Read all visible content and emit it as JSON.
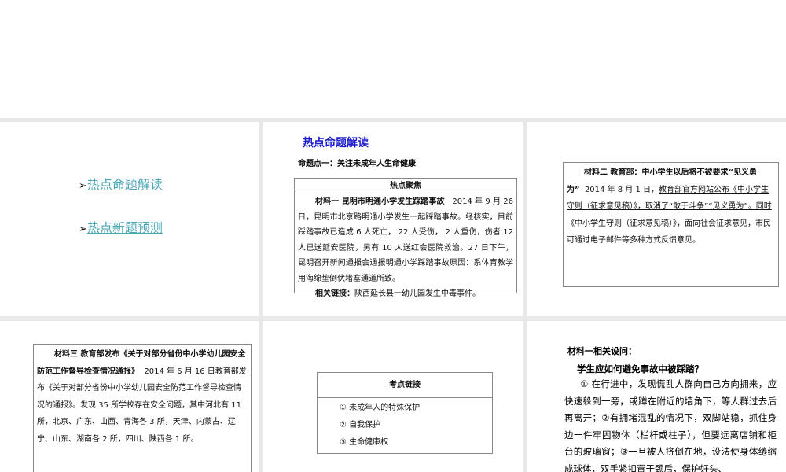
{
  "slide1": {
    "links": [
      "热点命题解读",
      "热点新题预测"
    ]
  },
  "slide2": {
    "title": "热点命题解读",
    "subtitle": "命题点一：关注未成年人生命健康",
    "box_header": "热点聚焦",
    "material_title": "材料一  昆明市明通小学发生踩踏事故",
    "material_body_1": "2014 年 9 月 26 日，昆明市北京路明通小学发生一起踩踏事故。经核实，目前踩踏事故已造成 6 人死亡， 22 人受伤， 2 人重伤，伤者 12 人已送延安医院，另有 10 人送红会医院救治。27 日下午，昆明召开新闻通报会通报明通小学踩踏事故原因：系体育教学用海绵垫倒伏堵塞通道所致。",
    "related_label": "相关链接：",
    "related_text": "陕西延长县一幼儿园发生中毒事件。"
  },
  "slide3": {
    "material_title": "材料二 教育部：中小学生以后将不被要求“见义勇为”",
    "date": "2014 年 8 月 1 日，",
    "underlined": "教育部官方网站公布《中小学生守则（征求意见稿）》，取消了“敢于斗争”“见义勇为”。同时《中小学生守则（征求意见稿）》，面向社会征求意见，",
    "rest": "市民可通过电子邮件等多种方式反馈意见。"
  },
  "slide4": {
    "material_title": "材料三 教育部发布《关于对部分省份中小学幼儿园安全防范工作督导检查情况通报》",
    "date": "2014 年 6 月 16 日教育",
    "body": "部发布《关于对部分省份中小学幼儿园安全防范工作督导检查情况的通报》。发现 35 所学校存在安全问题，其中河北有 11 所，北京、广东、山西、青海各 3 所，天津、内蒙古、辽宁、山东、湖南各 2 所，四川、陕西各 1 所。"
  },
  "slide5": {
    "box_header": "考点链接",
    "items": [
      "① 未成年人的特殊保护",
      "② 自我保护",
      "③ 生命健康权"
    ]
  },
  "slide6": {
    "heading": "材料一相关设问：",
    "question": "学生应如何避免事故中被踩踏？",
    "answer": "① 在行进中，发现慌乱人群向自己方向拥来，应快速躲到一旁，或蹲在附近的墙角下，等人群过去后再离开；②有拥堵混乱的情况下，双脚站稳，抓住身边一件牢固物体（栏杆或柱子），但要远离店铺和柜台的玻璃窗；③一旦被人挤倒在地，设法使身体绻缩成球体，双手紧扣置于颈后，保护好头、"
  },
  "colors": {
    "title_blue": "#1a1acc",
    "link_teal": "#4aa6b4",
    "gap_grey": "#e8e8e8"
  }
}
